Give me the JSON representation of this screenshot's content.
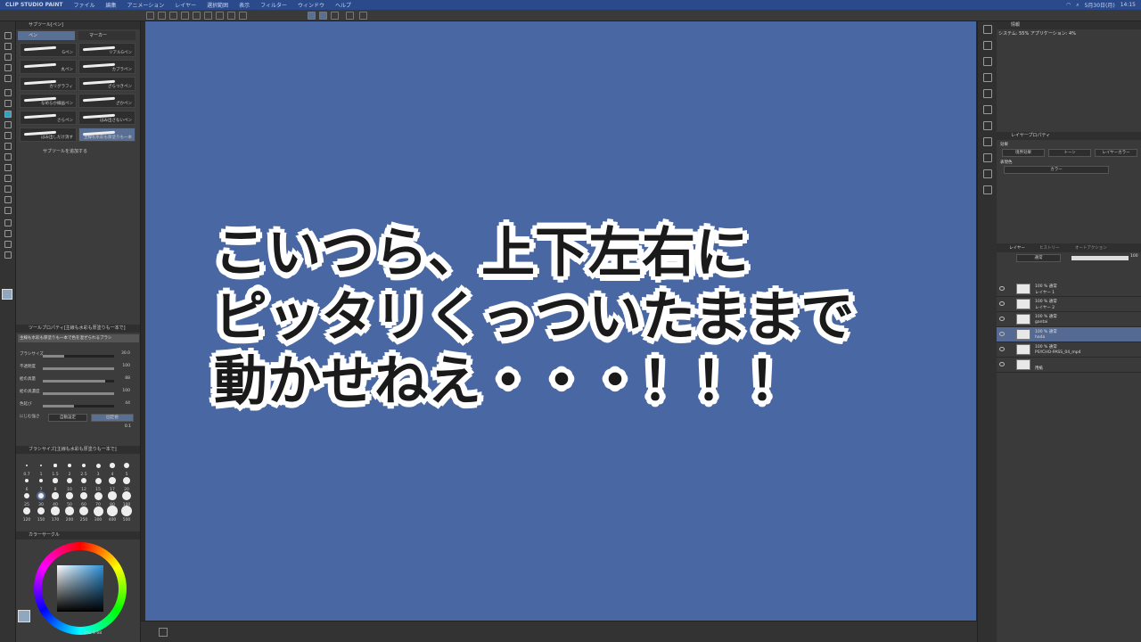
{
  "menubar": {
    "app": "CLIP STUDIO PAINT",
    "items": [
      "ファイル",
      "編集",
      "アニメーション",
      "レイヤー",
      "選択範囲",
      "表示",
      "フィルター",
      "ウィンドウ",
      "ヘルプ"
    ],
    "date": "5月30日(月)",
    "time": "14:15"
  },
  "subtool": {
    "title": "サブツール[ペン]",
    "tab_pen": "ペン",
    "tab_marker": "マーカー",
    "brushes": [
      "Gペン",
      "リアルGペン",
      "丸ペン",
      "カブラペン",
      "カリグラフィ",
      "ざらつきペン",
      "なめらか線画ペン",
      "ざかペン",
      "さらペン",
      "はみ出さないペン",
      "はみ出しだけ消す",
      "主線も水彩も厚塗りも一本"
    ],
    "add": "サブツールを追加する"
  },
  "toolprop": {
    "title": "ツールプロパティ[主線も水彩も厚塗りも一本で]",
    "brushname": "主線も水彩も厚塗りも一本で色を混ぜられるブラシ",
    "props": [
      {
        "label": "ブラシサイズ",
        "value": "30.0",
        "pct": 0.3
      },
      {
        "label": "不透明度",
        "value": "100",
        "pct": 1.0
      },
      {
        "label": "絵の具量",
        "value": "88",
        "pct": 0.88
      },
      {
        "label": "絵の具濃度",
        "value": "100",
        "pct": 1.0
      },
      {
        "label": "色延び",
        "value": "44",
        "pct": 0.44
      }
    ],
    "blend_label": "にじむ強さ",
    "auto": "自動設定",
    "fixed": "固定値",
    "blend_value": "0.1"
  },
  "brushsize": {
    "title": "ブラシサイズ[主線も水彩も厚塗りも一本で]",
    "row1": [
      "0.7",
      "1",
      "1.5",
      "2",
      "2.5",
      "3",
      "4",
      "5"
    ],
    "row2": [
      "6",
      "7",
      "8",
      "10",
      "12",
      "15",
      "17",
      "20"
    ],
    "row3": [
      "25",
      "30",
      "40",
      "50",
      "60",
      "70",
      "80",
      "100"
    ],
    "row4": [
      "120",
      "150",
      "170",
      "200",
      "250",
      "300",
      "400",
      "500"
    ]
  },
  "color": {
    "title": "カラーサークル",
    "hsv": "202",
    "v2": "9",
    "v3": "68"
  },
  "caption": {
    "line1": "こいつら、上下左右に",
    "line2": "ピッタリくっついたままで",
    "line3": "動かせねえ・・・！！！"
  },
  "navigator": {
    "title": "情報",
    "sys": "システム: 55%",
    "app": "アプリケーション: 4%"
  },
  "layerprop": {
    "title": "レイヤープロパティ",
    "effect": "効果",
    "border": "境界効果",
    "tone": "トーン",
    "layercolor": "レイヤーカラー",
    "display": "表現色",
    "colorval": "カラー"
  },
  "layers": {
    "tab_layer": "レイヤー",
    "tab_history": "ヒストリー",
    "tab_auto": "オートアクション",
    "blend": "通常",
    "opacity": "100",
    "list": [
      {
        "mode": "100 % 通常",
        "name": "レイヤー 1",
        "sel": false
      },
      {
        "mode": "100 % 通常",
        "name": "レイヤー 2",
        "sel": false
      },
      {
        "mode": "100 % 通常",
        "name": "gantai",
        "sel": false
      },
      {
        "mode": "100 % 通常",
        "name": "hada",
        "sel": true
      },
      {
        "mode": "100 % 通常",
        "name": "PSYCHO-PASS_04_mp4",
        "sel": false
      },
      {
        "mode": "",
        "name": "用紙",
        "sel": false
      }
    ]
  }
}
